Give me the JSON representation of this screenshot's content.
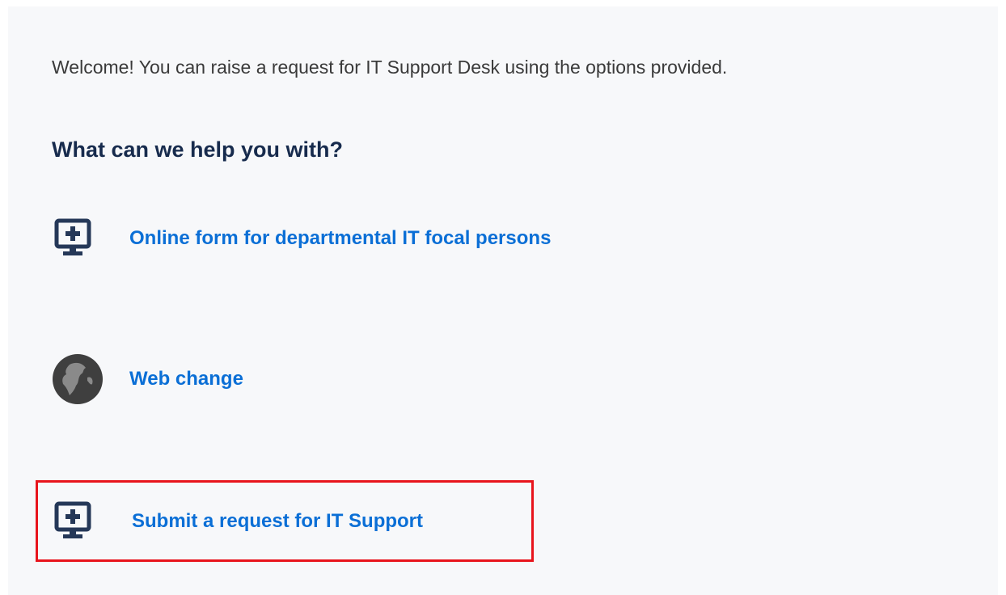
{
  "portal": {
    "welcome_text": "Welcome! You can raise a request for IT Support Desk using the options provided.",
    "heading": "What can we help you with?"
  },
  "options": [
    {
      "label": "Online form for departmental IT focal persons",
      "icon": "monitor-plus-icon"
    },
    {
      "label": "Web change",
      "icon": "globe-icon"
    },
    {
      "label": "Submit a request for IT Support",
      "icon": "monitor-plus-icon",
      "highlighted": true
    }
  ],
  "colors": {
    "link": "#0b6fd6",
    "heading": "#172b4d",
    "icon": "#253858",
    "highlight_border": "#e8141c",
    "panel_background": "#f7f8fa"
  }
}
